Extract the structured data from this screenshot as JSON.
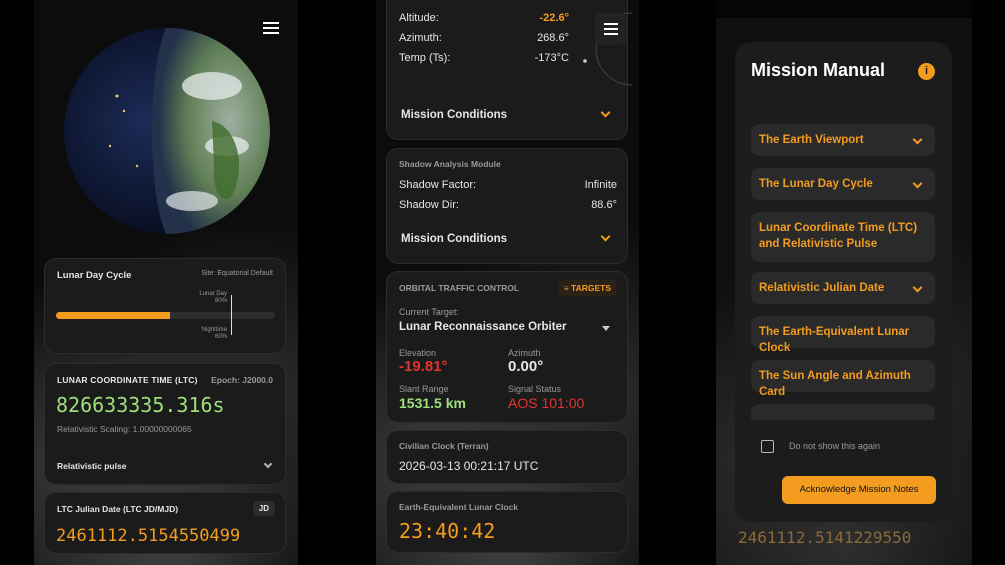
{
  "colors": {
    "accent": "#f39c1f",
    "negative": "#e3342f",
    "positive": "#9ee07a",
    "card": "#1b1b1b"
  },
  "panel1": {
    "lunar_day": {
      "title": "Lunar Day Cycle",
      "site": "Site: Equatorial Default",
      "progress": 0.52,
      "marker_label_top": "Lunar Day",
      "marker_pct_top": "80%",
      "marker_label_bottom": "Nighttime",
      "marker_pct_bottom": "60%"
    },
    "ltc": {
      "title": "LUNAR COORDINATE TIME (LTC)",
      "epoch": "Epoch: J2000.0",
      "value": "826633335.316s",
      "scaling": "Relativistic Scaling: 1.00000000065",
      "pulse_label": "Relativistic pulse"
    },
    "julian": {
      "title": "LTC Julian Date (LTC JD/MJD)",
      "badge": "JD",
      "value": "2461112.5154550499"
    }
  },
  "panel2": {
    "sun": {
      "altitude_label": "Altitude:",
      "altitude_value": "-22.6°",
      "azimuth_label": "Azimuth:",
      "azimuth_value": "268.6°",
      "temp_label": "Temp (Ts):",
      "temp_value": "-173°C",
      "conditions": "Mission Conditions"
    },
    "shadow": {
      "title": "Shadow Analysis Module",
      "factor_label": "Shadow Factor:",
      "factor_value": "Infinite",
      "dir_label": "Shadow Dir:",
      "dir_value": "88.6°",
      "conditions": "Mission Conditions"
    },
    "traffic": {
      "title": "ORBITAL TRAFFIC CONTROL",
      "targets_btn": "TARGETS",
      "current_label": "Current Target:",
      "current_value": "Lunar Reconnaissance Orbiter",
      "elev_label": "Elevation",
      "elev_value": "-19.81°",
      "azim_label": "Azimuth",
      "azim_value": "0.00°",
      "range_label": "Slant Range",
      "range_value": "1531.5 km",
      "signal_label": "Signal Status",
      "signal_value": "AOS 101:00"
    },
    "civil": {
      "title": "Civilian Clock (Terran)",
      "value": "2026-03-13 00:21:17 UTC"
    },
    "earth_clock": {
      "title": "Earth-Equivalent Lunar Clock",
      "value": "23:40:42"
    }
  },
  "panel3": {
    "title": "Mission Manual",
    "info_icon": "info-icon",
    "items": [
      {
        "label": "The Earth Viewport"
      },
      {
        "label": "The Lunar Day Cycle"
      },
      {
        "label": "Lunar Coordinate Time (LTC) and Relativistic Pulse"
      },
      {
        "label": "Relativistic Julian Date"
      },
      {
        "label": "The Earth-Equivalent Lunar Clock"
      },
      {
        "label": "The Sun Angle and Azimuth Card"
      }
    ],
    "checkbox_label": "Do not show this again",
    "ack_button": "Acknowledge Mission Notes",
    "bg_value": "2461112.5141229550"
  }
}
